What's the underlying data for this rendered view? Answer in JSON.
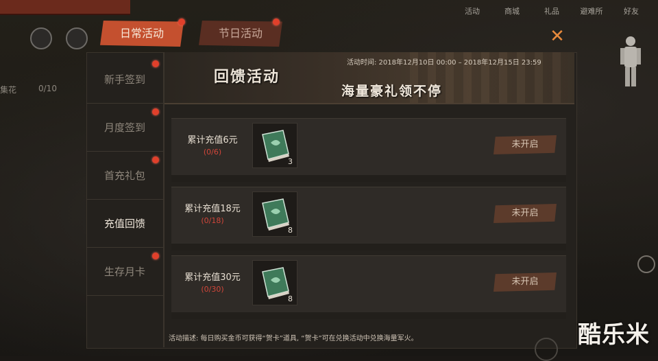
{
  "top_nav": {
    "items": [
      {
        "label": "活动"
      },
      {
        "label": "商城"
      },
      {
        "label": "礼品"
      },
      {
        "label": "避难所"
      },
      {
        "label": "好友"
      }
    ]
  },
  "left_hud": {
    "label": "集花",
    "count": "0/10"
  },
  "tabs": [
    {
      "label": "日常活动",
      "active": true
    },
    {
      "label": "节日活动",
      "active": false
    }
  ],
  "sidebar": {
    "items": [
      {
        "label": "新手签到",
        "active": false
      },
      {
        "label": "月度签到",
        "active": false
      },
      {
        "label": "首充礼包",
        "active": false
      },
      {
        "label": "充值回馈",
        "active": true
      },
      {
        "label": "生存月卡",
        "active": false
      }
    ]
  },
  "banner": {
    "title": "回馈活动",
    "time": "活动时间: 2018年12月10日 00:00 – 2018年12月15日 23:59",
    "slogan": "海量豪礼领不停"
  },
  "rewards": [
    {
      "name": "累计充值6元",
      "progress": "(0/6)",
      "count": "3",
      "status": "未开启"
    },
    {
      "name": "累计充值18元",
      "progress": "(0/18)",
      "count": "8",
      "status": "未开启"
    },
    {
      "name": "累计充值30元",
      "progress": "(0/30)",
      "count": "8",
      "status": "未开启"
    }
  ],
  "description": "活动描述: 每日购买金币可获得“贺卡”道具, “贺卡”可在兑换活动中兑换海量军火。",
  "watermark": "酷乐米",
  "colors": {
    "accent": "#c4502f",
    "notify": "#e0402b",
    "close": "#e98a3c",
    "progress": "#d2463a"
  }
}
